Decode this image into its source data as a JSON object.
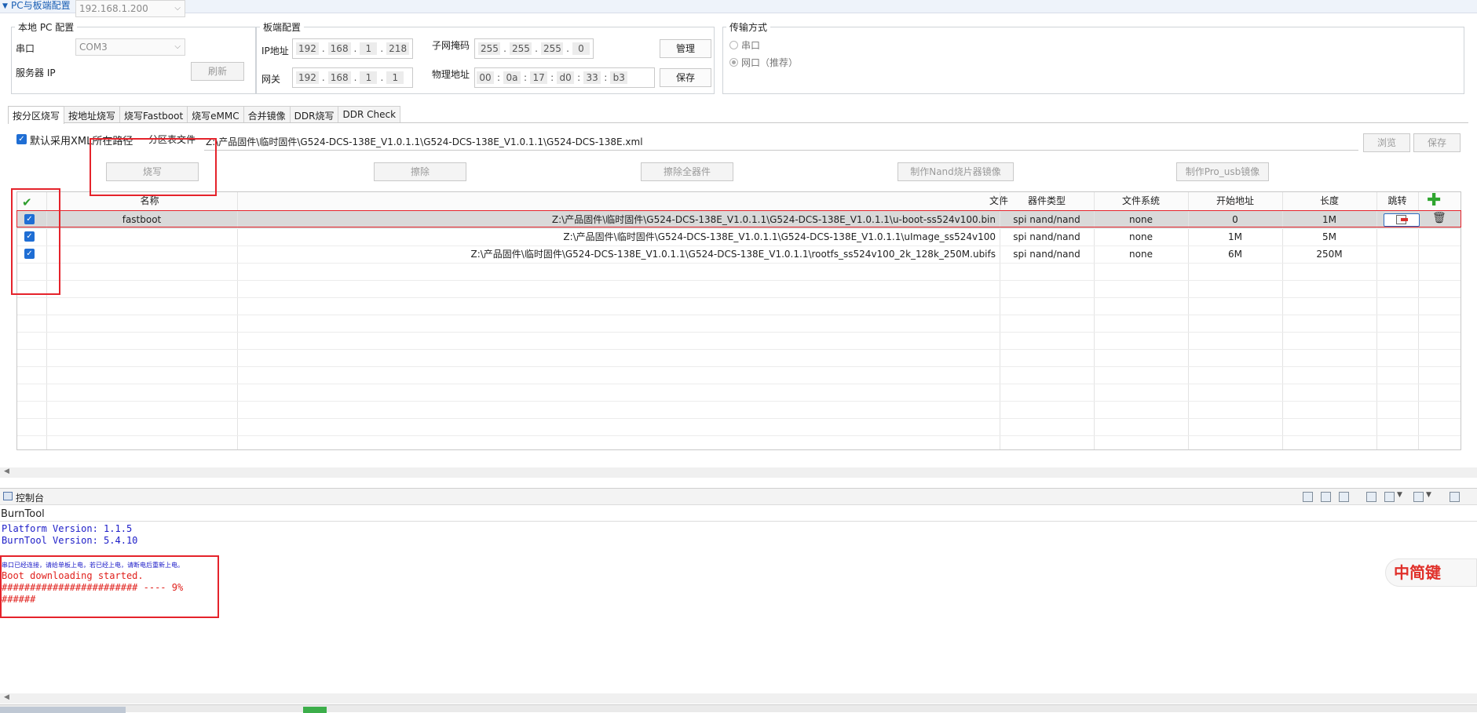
{
  "section": {
    "title": "PC与板端配置"
  },
  "local": {
    "legend": "本地 PC 配置",
    "serial_label": "串口",
    "serial_value": "COM3",
    "server_ip_label": "服务器 IP",
    "server_ip_value": "192.168.1.200",
    "refresh_label": "刷新"
  },
  "board": {
    "legend": "板端配置",
    "ip_label": "IP地址",
    "ip": [
      "192",
      "168",
      "1",
      "218"
    ],
    "gateway_label": "网关",
    "gateway": [
      "192",
      "168",
      "1",
      "1"
    ],
    "mask_label": "子网掩码",
    "mask": [
      "255",
      "255",
      "255",
      "0"
    ],
    "mac_label": "物理地址",
    "mac": [
      "00",
      "0a",
      "17",
      "d0",
      "33",
      "b3"
    ],
    "manage_label": "管理",
    "save_label": "保存"
  },
  "transport": {
    "legend": "传输方式",
    "serial_option": "串口",
    "net_option": "网口（推荐）"
  },
  "tabs": [
    "按分区烧写",
    "按地址烧写",
    "烧写Fastboot",
    "烧写eMMC",
    "合并镜像",
    "DDR烧写",
    "DDR Check"
  ],
  "partition": {
    "default_xml_label": "默认采用XML所在路径",
    "table_file_label": "分区表文件",
    "xml_path": "Z:\\产品固件\\临时固件\\G524-DCS-138E_V1.0.1.1\\G524-DCS-138E_V1.0.1.1\\G524-DCS-138E.xml",
    "browse_label": "浏览",
    "save_label": "保存",
    "burn_label": "烧写",
    "erase_label": "擦除",
    "erase_all_label": "擦除全器件",
    "make_nand_label": "制作Nand烧片器镜像",
    "make_prousb_label": "制作Pro_usb镜像"
  },
  "table": {
    "headers": {
      "name": "名称",
      "file": "文件",
      "device": "器件类型",
      "fs": "文件系统",
      "start": "开始地址",
      "length": "长度",
      "jump": "跳转"
    },
    "rows": [
      {
        "name": "fastboot",
        "file": "Z:\\产品固件\\临时固件\\G524-DCS-138E_V1.0.1.1\\G524-DCS-138E_V1.0.1.1\\u-boot-ss524v100.bin",
        "device": "spi nand/nand",
        "fs": "none",
        "start": "0",
        "length": "1M"
      },
      {
        "name": "",
        "file": "Z:\\产品固件\\临时固件\\G524-DCS-138E_V1.0.1.1\\G524-DCS-138E_V1.0.1.1\\uImage_ss524v100",
        "device": "spi nand/nand",
        "fs": "none",
        "start": "1M",
        "length": "5M"
      },
      {
        "name": "",
        "file": "Z:\\产品固件\\临时固件\\G524-DCS-138E_V1.0.1.1\\G524-DCS-138E_V1.0.1.1\\rootfs_ss524v100_2k_128k_250M.ubifs",
        "device": "spi nand/nand",
        "fs": "none",
        "start": "6M",
        "length": "250M"
      }
    ]
  },
  "console": {
    "tab_label": "控制台",
    "title": "BurnTool",
    "info_lines": [
      "Platform Version: 1.1.5",
      "BurnTool Version: 5.4.10"
    ],
    "notice": "串口已经连接，请给单板上电，若已经上电，请断电后重新上电。",
    "log_lines": [
      "Boot downloading started.",
      "######################## ---- 9%",
      "######"
    ]
  },
  "watermark": "中简键",
  "colors": {
    "accent": "#1a5fb4",
    "highlight": "#e5232b",
    "check_blue": "#1f6ed4",
    "log_red": "#e0201c",
    "info_blue": "#1c1cc8"
  }
}
